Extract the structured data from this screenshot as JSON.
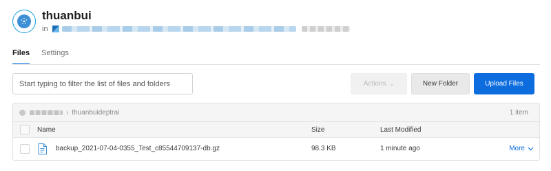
{
  "header": {
    "title": "thuanbui",
    "in_label": "in"
  },
  "tabs": [
    {
      "label": "Files",
      "active": true
    },
    {
      "label": "Settings",
      "active": false
    }
  ],
  "toolbar": {
    "filter_placeholder": "Start typing to filter the list of files and folders",
    "actions_label": "Actions",
    "new_folder_label": "New Folder",
    "upload_label": "Upload Files"
  },
  "breadcrumb": {
    "current": "thuanbuideptrai",
    "item_count": "1 item"
  },
  "columns": {
    "name": "Name",
    "size": "Size",
    "modified": "Last Modified"
  },
  "files": [
    {
      "name": "backup_2021-07-04-0355_Test_c85544709137-db.gz",
      "size": "98.3 KB",
      "modified": "1 minute ago",
      "more_label": "More"
    }
  ],
  "colors": {
    "accent": "#0d6ddf",
    "avatar_ring": "#0e9de0"
  },
  "icons": {
    "avatar": "bucket-globe-icon",
    "file": "file-document-icon",
    "more_chevron": "chevron-down-icon",
    "actions_chevron": "chevron-down-icon"
  }
}
